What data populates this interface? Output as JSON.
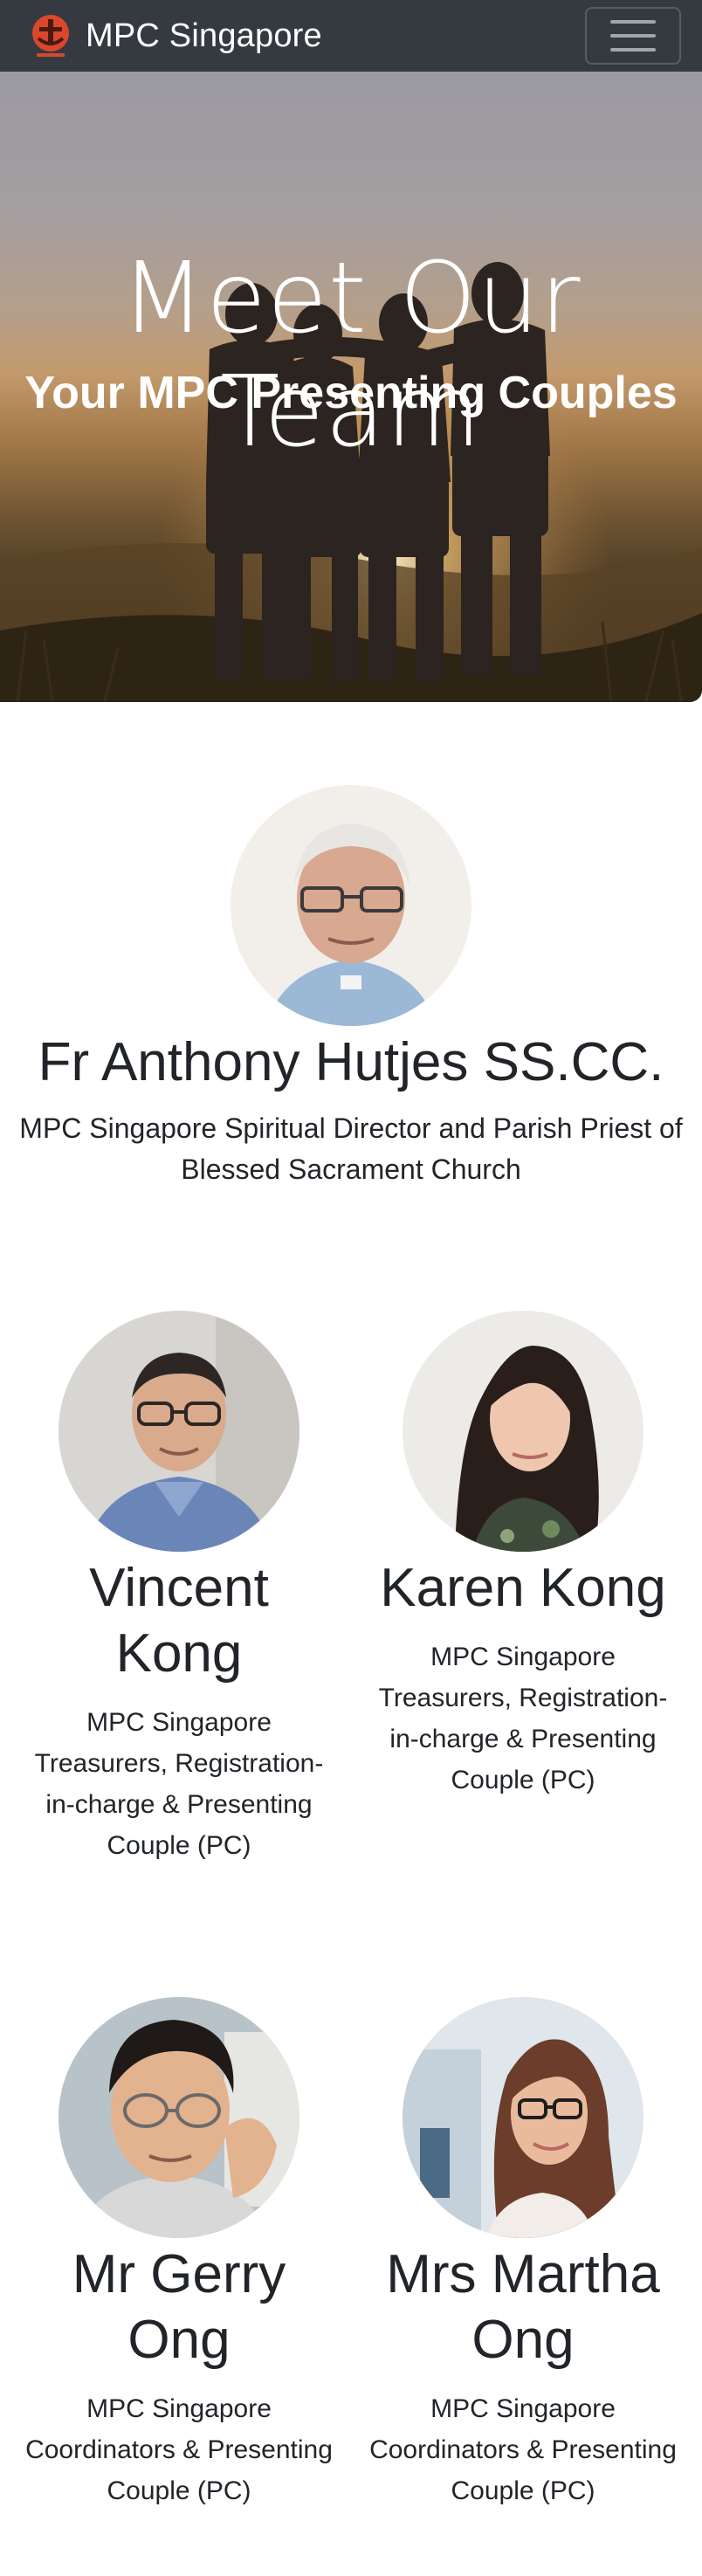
{
  "navbar": {
    "brand": "MPC Singapore",
    "logo_icon": "mpc-cross-logo-icon",
    "toggle_icon": "hamburger-menu-icon",
    "bg_color": "#343a40"
  },
  "hero": {
    "title": "Meet Our Team",
    "subtitle": "Your MPC Presenting Couples"
  },
  "lead": {
    "name": "Fr Anthony Hutjes SS.CC.",
    "role": "MPC Singapore Spiritual Director and Parish Priest of Blessed Sacrament Church"
  },
  "members": [
    {
      "name": "Vincent Kong",
      "role": "MPC Singapore Treasurers, Registration-in-charge & Presenting Couple (PC)"
    },
    {
      "name": "Karen Kong",
      "role": "MPC Singapore Treasurers, Registration-in-charge & Presenting Couple (PC)"
    },
    {
      "name": "Mr Gerry Ong",
      "role": "MPC Singapore Coordinators & Presenting Couple (PC)"
    },
    {
      "name": "Mrs Martha Ong",
      "role": "MPC Singapore Coordinators & Presenting Couple (PC)"
    }
  ]
}
